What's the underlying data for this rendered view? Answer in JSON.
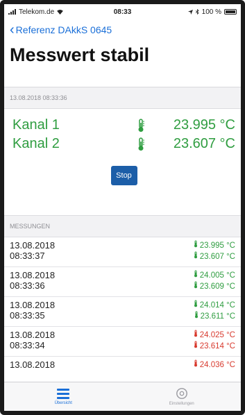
{
  "status_bar": {
    "carrier": "Telekom.de",
    "time": "08:33",
    "battery": "100 %"
  },
  "nav": {
    "back_label": "Referenz DAkkS 0645",
    "title": "Messwert stabil"
  },
  "current": {
    "timestamp": "13.08.2018 08:33:36",
    "channels": [
      {
        "name": "Kanal 1",
        "value": "23.995 °C"
      },
      {
        "name": "Kanal 2",
        "value": "23.607 °C"
      }
    ],
    "stop_label": "Stop"
  },
  "measurements": {
    "header": "MESSUNGEN",
    "rows": [
      {
        "date": "13.08.2018",
        "time": "08:33:37",
        "v1": "23.995 °C",
        "v2": "23.607 °C",
        "status": "green"
      },
      {
        "date": "13.08.2018",
        "time": "08:33:36",
        "v1": "24.005 °C",
        "v2": "23.609 °C",
        "status": "green"
      },
      {
        "date": "13.08.2018",
        "time": "08:33:35",
        "v1": "24.014 °C",
        "v2": "23.611 °C",
        "status": "green"
      },
      {
        "date": "13.08.2018",
        "time": "08:33:34",
        "v1": "24.025 °C",
        "v2": "23.614 °C",
        "status": "red"
      },
      {
        "date": "13.08.2018",
        "time": "",
        "v1": "24.036 °C",
        "v2": "",
        "status": "red"
      }
    ]
  },
  "tabs": [
    {
      "label": "Übersicht",
      "icon": "list-icon",
      "active": true
    },
    {
      "label": "Einstellungen",
      "icon": "gear-icon",
      "active": false
    }
  ],
  "colors": {
    "ok": "#2f9d40",
    "alarm": "#d83a2e",
    "accent": "#1a6fd8",
    "button": "#1c5ea8"
  }
}
